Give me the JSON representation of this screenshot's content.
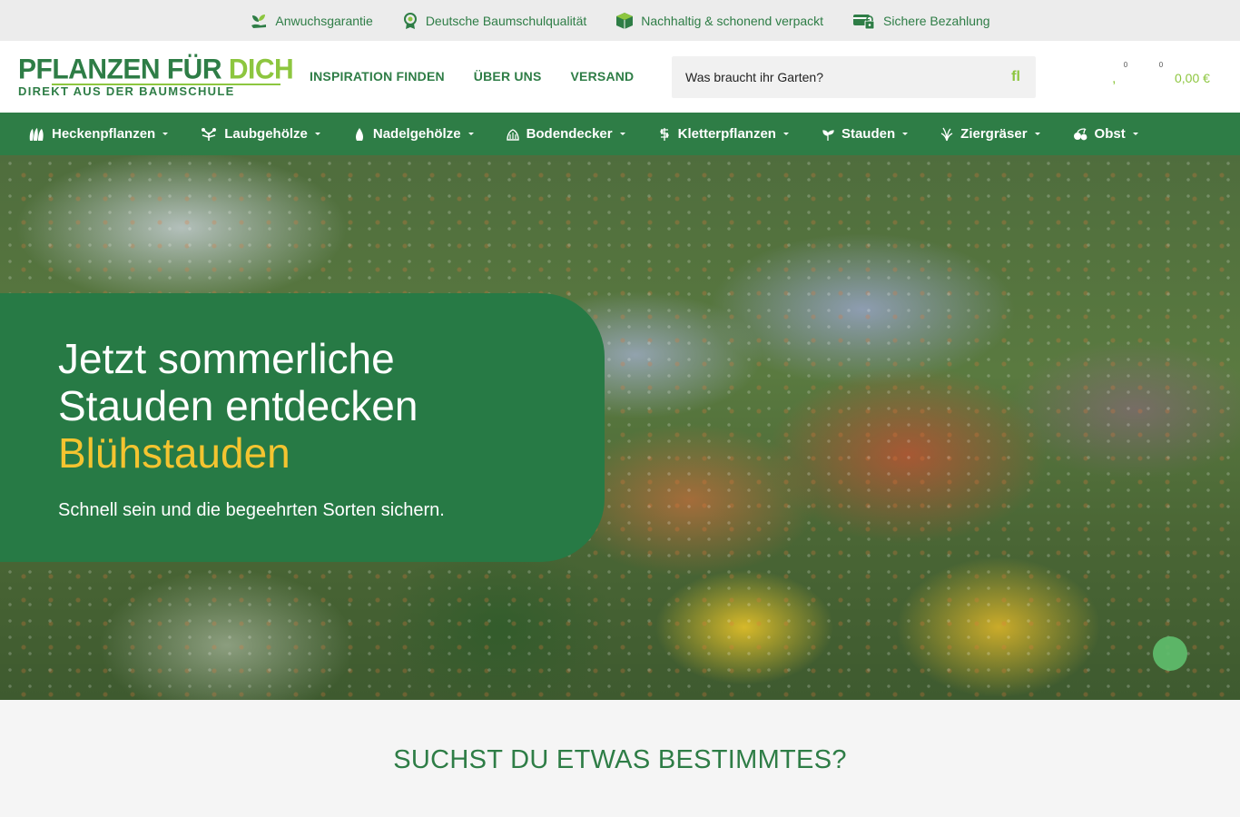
{
  "trustbar": {
    "items": [
      {
        "label": "Anwuchsgarantie",
        "icon": "sprout-hand-icon"
      },
      {
        "label": "Deutsche Baumschulqualität",
        "icon": "quality-badge-icon"
      },
      {
        "label": "Nachhaltig & schonend verpackt",
        "icon": "package-icon"
      },
      {
        "label": "Sichere Bezahlung",
        "icon": "secure-payment-icon"
      }
    ]
  },
  "header": {
    "logo": {
      "line1_main": "PFLANZEN FÜR ",
      "line1_accent": "DICH",
      "line2": "DIREKT AUS DER BAUMSCHULE"
    },
    "nav": [
      "INSPIRATION FINDEN",
      "ÜBER UNS",
      "VERSAND"
    ],
    "search": {
      "placeholder": "Was braucht ihr Garten?",
      "icon": "fl"
    },
    "account_icon": "",
    "wishlist_icon": ",",
    "wishlist_count": "0",
    "cart_icon": "",
    "cart_count": "0",
    "cart_total": "0,00 €"
  },
  "categories": [
    {
      "label": "Heckenpflanzen",
      "icon": "hedge-icon"
    },
    {
      "label": "Laubgehölze",
      "icon": "deciduous-icon"
    },
    {
      "label": "Nadelgehölze",
      "icon": "conifer-icon"
    },
    {
      "label": "Bodendecker",
      "icon": "groundcover-icon"
    },
    {
      "label": "Kletterpflanzen",
      "icon": "climber-icon"
    },
    {
      "label": "Stauden",
      "icon": "perennial-icon"
    },
    {
      "label": "Ziergräser",
      "icon": "grass-icon"
    },
    {
      "label": "Obst",
      "icon": "fruit-icon"
    }
  ],
  "hero": {
    "line1": "Jetzt sommerliche",
    "line2": "Stauden entdecken",
    "highlight": "Blühstauden",
    "subtitle": "Schnell sein und die begeehrten Sorten sichern."
  },
  "section": {
    "title": "SUCHST DU ETWAS BESTIMMTES?"
  },
  "colors": {
    "brand_green": "#2e7d46",
    "accent_green": "#8dc63f",
    "hero_card": "#277a45",
    "highlight_yellow": "#f4c430"
  }
}
